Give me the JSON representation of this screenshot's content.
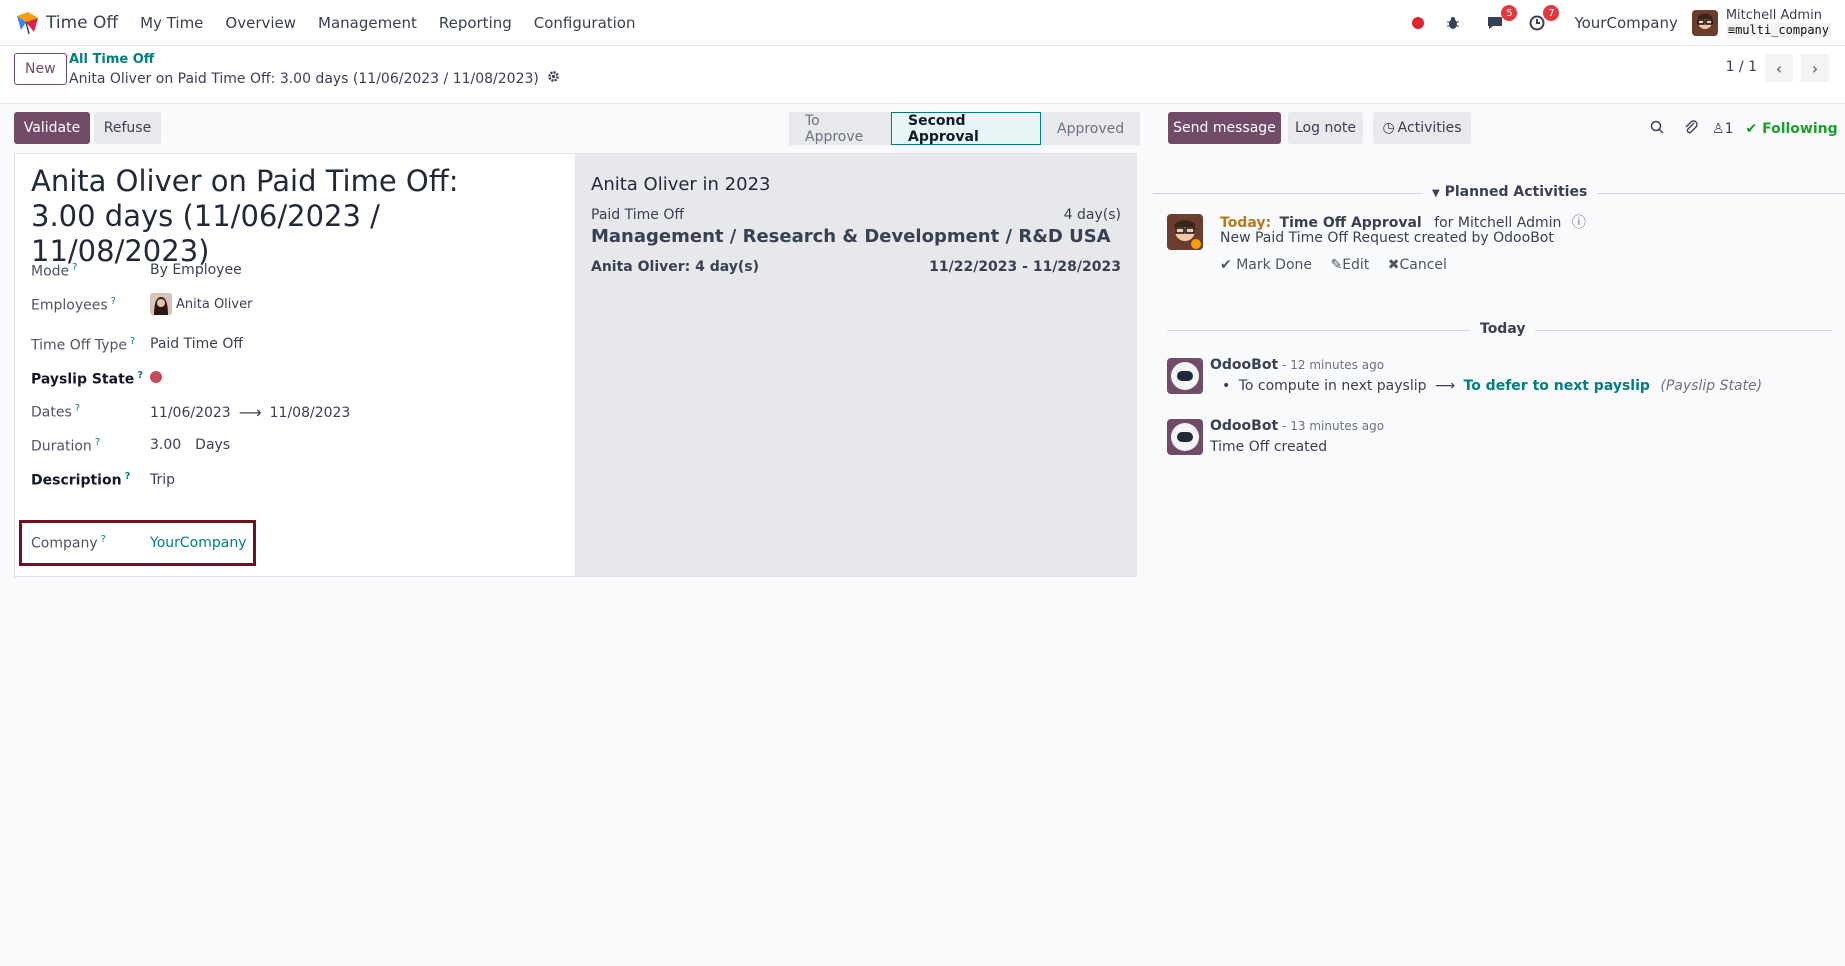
{
  "navbar": {
    "app_name": "Time Off",
    "menu": [
      "My Time",
      "Overview",
      "Management",
      "Reporting",
      "Configuration"
    ],
    "messages_badge": "5",
    "activities_badge": "7",
    "company": "YourCompany",
    "user_name": "Mitchell Admin",
    "user_db": "multi_company"
  },
  "control": {
    "new_label": "New",
    "breadcrumb": "All Time Off",
    "record_title": "Anita Oliver on Paid Time Off: 3.00 days (11/06/2023 / 11/08/2023)",
    "pager": "1 / 1"
  },
  "actions": {
    "validate": "Validate",
    "refuse": "Refuse"
  },
  "statusbar": {
    "stages": [
      "To Approve",
      "Second Approval",
      "Approved"
    ],
    "active": "Second Approval"
  },
  "form": {
    "title": "Anita Oliver on Paid Time Off: 3.00 days (11/06/2023 / 11/08/2023)",
    "mode_label": "Mode",
    "mode_value": "By Employee",
    "employees_label": "Employees",
    "employees_value": "Anita Oliver",
    "type_label": "Time Off Type",
    "type_value": "Paid Time Off",
    "payslip_label": "Payslip State",
    "dates_label": "Dates",
    "date_from": "11/06/2023",
    "date_to": "11/08/2023",
    "duration_label": "Duration",
    "duration_value": "3.00",
    "duration_unit": "Days",
    "description_label": "Description",
    "description_value": "Trip",
    "company_label": "Company",
    "company_value": "YourCompany",
    "help_mark": "?"
  },
  "side_panel": {
    "title": "Anita Oliver in 2023",
    "type": "Paid Time Off",
    "days": "4 day(s)",
    "department": "Management / Research & Development / R&D USA",
    "employee_days": "Anita Oliver: 4 day(s)",
    "date_range": "11/22/2023 - 11/28/2023"
  },
  "chatter": {
    "send_message": "Send message",
    "log_note": "Log note",
    "activities": "Activities",
    "followers_count": "1",
    "following": "Following",
    "planned_title": "Planned Activities",
    "activity": {
      "when": "Today:",
      "name": "Time Off Approval",
      "for": "for Mitchell Admin",
      "note": "New Paid Time Off Request created by OdooBot",
      "mark_done": "Mark Done",
      "edit": "Edit",
      "cancel": "Cancel"
    },
    "today_label": "Today",
    "messages": [
      {
        "author": "OdooBot",
        "date": "- 12 minutes ago",
        "old_value": "To compute in next payslip",
        "new_value": "To defer to next payslip",
        "field": "(Payslip State)"
      },
      {
        "author": "OdooBot",
        "date": "- 13 minutes ago",
        "body": "Time Off created"
      }
    ]
  }
}
